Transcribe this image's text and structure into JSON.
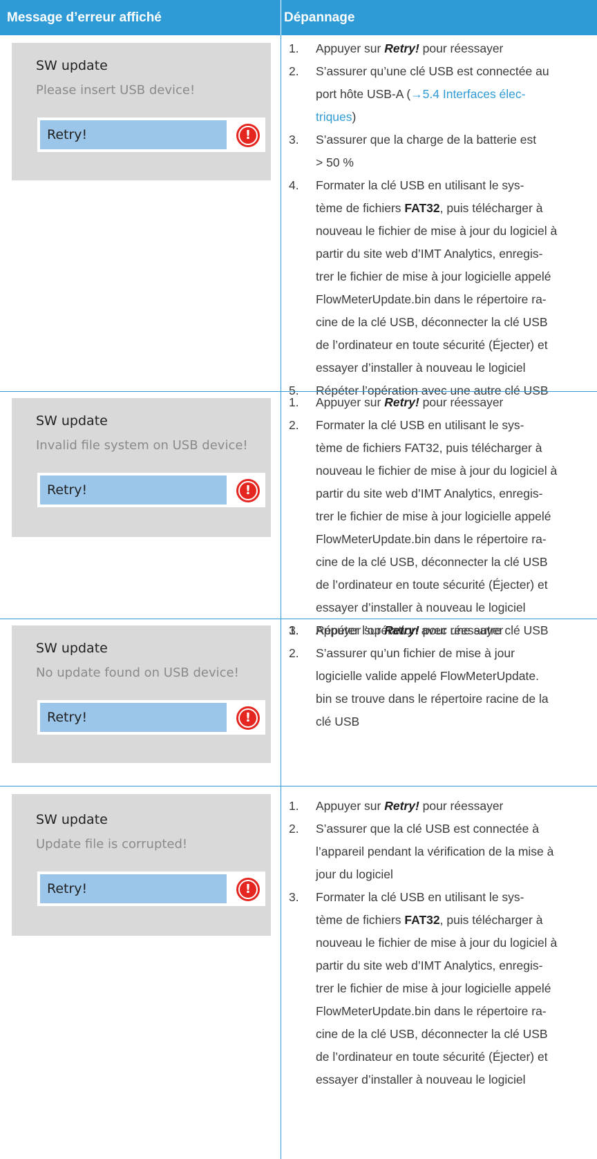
{
  "header": {
    "col1": "Message d’erreur affiché",
    "col2": "Dépannage"
  },
  "rows": [
    {
      "screen": {
        "title": "SW update",
        "message": "Please insert USB device!",
        "button": "Retry!"
      },
      "steps": [
        {
          "num": "1.",
          "lines": [
            [
              "Appuyer sur ",
              "Retry!",
              " pour réessayer"
            ]
          ]
        },
        {
          "num": "2.",
          "lines": [
            "S’assurer qu’une clé USB est connectée au",
            [
              "port hôte USB-A (",
              "→5.4 Interfaces élec-",
              ""
            ],
            [
              "",
              "triques",
              ")"
            ]
          ]
        },
        {
          "num": "3.",
          "lines": [
            "S’assurer que la charge de la batterie est",
            "> 50 %"
          ]
        },
        {
          "num": "4.",
          "lines": [
            "Formater la clé USB en utilisant le sys-",
            [
              "tème de fichiers ",
              "FAT32",
              ", puis télécharger à"
            ],
            "nouveau le fichier de mise à jour du logiciel à",
            "partir du site web d’IMT Analytics, enregis-",
            "trer le fichier de mise à jour logicielle appelé",
            "FlowMeterUpdate.bin dans le répertoire ra-",
            "cine de la clé USB, déconnecter la clé USB",
            "de l’ordinateur en toute sécurité (Éjecter) et",
            "essayer d’installer à nouveau le logiciel"
          ]
        },
        {
          "num": "5.",
          "lines": [
            "Répéter l’opération avec une autre clé USB"
          ]
        }
      ]
    },
    {
      "screen": {
        "title": "SW update",
        "message": "Invalid file system on USB device!",
        "button": "Retry!"
      },
      "steps": [
        {
          "num": "1.",
          "lines": [
            [
              "Appuyer sur ",
              "Retry!",
              " pour réessayer"
            ]
          ]
        },
        {
          "num": "2.",
          "lines": [
            "Formater la clé USB en utilisant le sys-",
            "tème de fichiers FAT32, puis télécharger à",
            "nouveau le fichier de mise à jour du logiciel à",
            "partir du site web d’IMT Analytics, enregis-",
            "trer le fichier de mise à jour logicielle appelé",
            "FlowMeterUpdate.bin dans le répertoire ra-",
            "cine de la clé USB, déconnecter la clé USB",
            "de l’ordinateur en toute sécurité (Éjecter) et",
            "essayer d’installer à nouveau le logiciel"
          ]
        },
        {
          "num": "3.",
          "lines": [
            "Répéter l’opération avec une autre clé USB"
          ]
        }
      ]
    },
    {
      "screen": {
        "title": "SW update",
        "message": "No update found on USB device!",
        "button": "Retry!"
      },
      "steps": [
        {
          "num": "1.",
          "lines": [
            [
              "Appuyer sur ",
              "Retry!",
              " pour réessayer"
            ]
          ]
        },
        {
          "num": "2.",
          "lines": [
            "S’assurer qu’un fichier de mise à jour",
            "logicielle valide appelé FlowMeterUpdate.",
            "bin se trouve dans le répertoire racine de la",
            "clé USB"
          ]
        }
      ]
    },
    {
      "screen": {
        "title": "SW update",
        "message": "Update file is corrupted!",
        "button": "Retry!"
      },
      "steps": [
        {
          "num": "1.",
          "lines": [
            [
              "Appuyer sur ",
              "Retry!",
              " pour réessayer"
            ]
          ]
        },
        {
          "num": "2.",
          "lines": [
            "S’assurer que la clé USB est connectée à",
            "l’appareil pendant la vérification de la mise à",
            "jour du logiciel"
          ]
        },
        {
          "num": "3.",
          "lines": [
            "Formater la clé USB en utilisant le sys-",
            [
              "tème de fichiers ",
              "FAT32",
              ", puis télécharger à"
            ],
            "nouveau le fichier de mise à jour du logiciel à",
            "partir du site web d’IMT Analytics, enregis-",
            "trer le fichier de mise à jour logicielle appelé",
            "FlowMeterUpdate.bin dans le répertoire ra-",
            "cine de la clé USB, déconnecter la clé USB",
            "de l’ordinateur en toute sécurité (Éjecter) et",
            "essayer d’installer à nouveau le logiciel"
          ]
        }
      ]
    }
  ],
  "colors": {
    "accent": "#2f9bd6",
    "screen_bg": "#d9d9d9",
    "button": "#9cc6e9",
    "warning": "#e52620"
  },
  "icons": {
    "warning": "exclamation-circle-icon",
    "link_arrow": "arrow-right-icon"
  }
}
